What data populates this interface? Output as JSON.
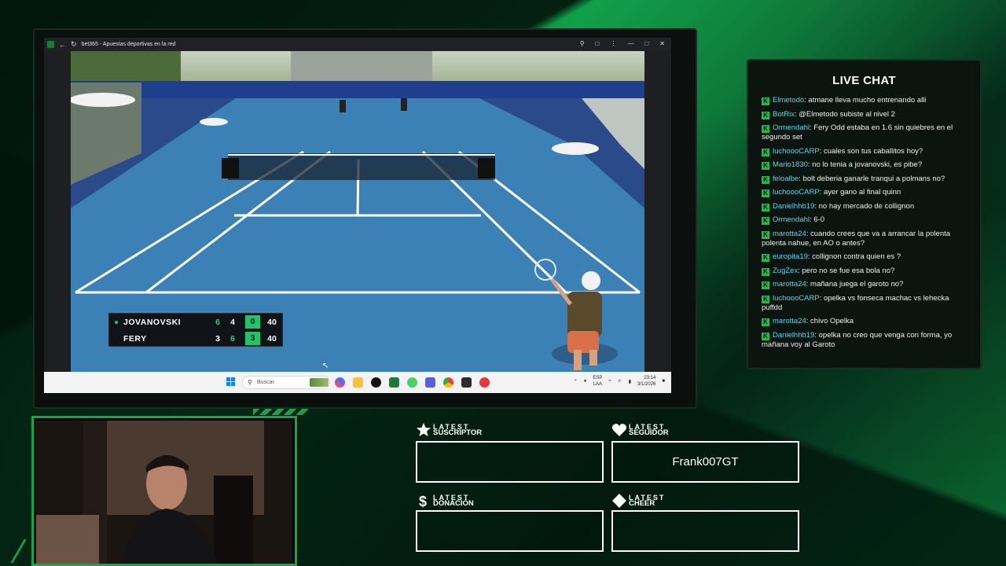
{
  "browser": {
    "tab_title": "bet365 - Apuestas deportivas en la red",
    "titlebar_icons": [
      "search-icon",
      "extension-icon",
      "more-icon",
      "minimize-icon",
      "restore-icon",
      "close-icon"
    ]
  },
  "scoreboard": {
    "players": [
      {
        "name": "JOVANOVSKI",
        "serving": true,
        "set1": "6",
        "set2": "4",
        "set3": "0",
        "points": "40"
      },
      {
        "name": "FERY",
        "serving": false,
        "set1": "3",
        "set2": "6",
        "set3": "3",
        "points": "40"
      }
    ]
  },
  "taskbar": {
    "search_placeholder": "Buscar",
    "lang_line1": "ESP",
    "lang_line2": "LAA",
    "time": "23:14",
    "date": "3/1/2026"
  },
  "chat": {
    "title": "LIVE CHAT",
    "messages": [
      {
        "user": "Elmetodo",
        "text": ": atmane lleva mucho entrenando alli"
      },
      {
        "user": "BotRix",
        "text": ": @Elmetodo subiste al nivel 2"
      },
      {
        "user": "Ormendahl",
        "text": ": Fery Odd estaba en 1.6 sin quiebres en el segundo set"
      },
      {
        "user": "luchoooCARP",
        "text": ": cuales son tus caballitos hoy?"
      },
      {
        "user": "Mario1830",
        "text": ": no lo tenia a jovanovski, es pibe?"
      },
      {
        "user": "feloalbe",
        "text": ": bolt deberia ganarle tranqui a polmans no?"
      },
      {
        "user": "luchoooCARP",
        "text": ": ayer gano al final quinn"
      },
      {
        "user": "Danielhhb19",
        "text": ": no hay mercado de collignon"
      },
      {
        "user": "Ormendahl",
        "text": ": 6-0"
      },
      {
        "user": "marotta24",
        "text": ": cuando crees que va a arrancar la polenta polenta nahue, en AO o antes?"
      },
      {
        "user": "europita19",
        "text": ": collignon contra quien es ?"
      },
      {
        "user": "ZugZex",
        "text": ": pero no se fue esa bola no?"
      },
      {
        "user": "marotta24",
        "text": ": mañana juega el garoto no?"
      },
      {
        "user": "luchoooCARP",
        "text": ": opelka vs fonseca machac vs lehecka puffdd"
      },
      {
        "user": "marotta24",
        "text": ": chivo Opelka"
      },
      {
        "user": "Danielhhb19",
        "text": ": opelka no creo que venga con forma, yo mañana voy al Garoto"
      }
    ]
  },
  "alerts": {
    "suscriptor": {
      "line1": "LATEST",
      "line2": "SUSCRIPTOR",
      "value": ""
    },
    "seguidor": {
      "line1": "LATEST",
      "line2": "SEGUIDOR",
      "value": "Frank007GT"
    },
    "donacion": {
      "line1": "LATEST",
      "line2": "DONACIÓN",
      "value": ""
    },
    "cheer": {
      "line1": "LATEST",
      "line2": "CHEER",
      "value": ""
    }
  },
  "colors": {
    "accent_green": "#22b84f",
    "chat_username": "#62d3e6",
    "score_highlight": "#25c06a"
  }
}
